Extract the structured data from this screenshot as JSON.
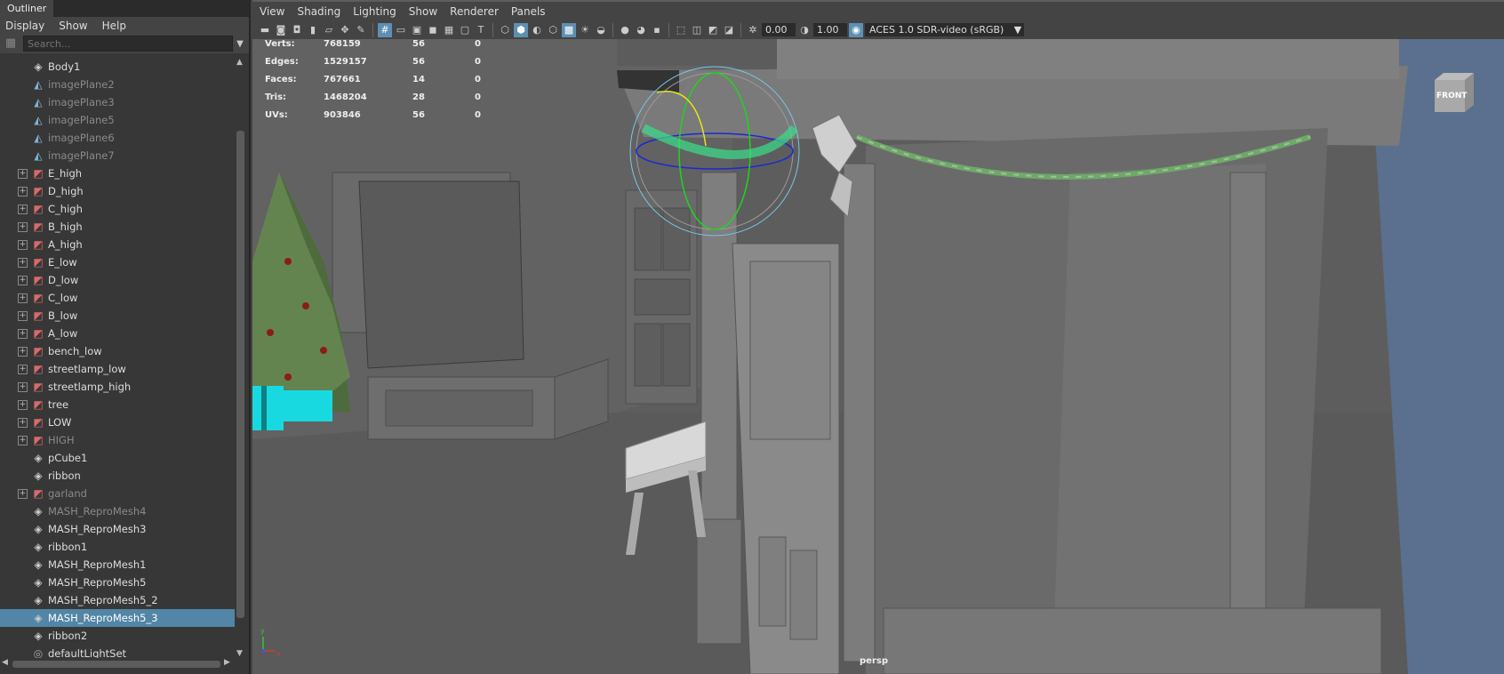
{
  "outliner": {
    "title": "Outliner",
    "menu": [
      "Display",
      "Show",
      "Help"
    ],
    "search_placeholder": "Search...",
    "items": [
      {
        "label": "Body1",
        "icon": "mesh-icon",
        "expand": false,
        "dim": false,
        "selected": false
      },
      {
        "label": "imagePlane2",
        "icon": "image-plane-icon",
        "expand": false,
        "dim": true,
        "selected": false
      },
      {
        "label": "imagePlane3",
        "icon": "image-plane-icon",
        "expand": false,
        "dim": true,
        "selected": false
      },
      {
        "label": "imagePlane5",
        "icon": "image-plane-icon",
        "expand": false,
        "dim": true,
        "selected": false
      },
      {
        "label": "imagePlane6",
        "icon": "image-plane-icon",
        "expand": false,
        "dim": true,
        "selected": false
      },
      {
        "label": "imagePlane7",
        "icon": "image-plane-icon",
        "expand": false,
        "dim": true,
        "selected": false
      },
      {
        "label": "E_high",
        "icon": "group-icon",
        "expand": true,
        "dim": false,
        "selected": false
      },
      {
        "label": "D_high",
        "icon": "group-icon",
        "expand": true,
        "dim": false,
        "selected": false
      },
      {
        "label": "C_high",
        "icon": "group-icon",
        "expand": true,
        "dim": false,
        "selected": false
      },
      {
        "label": "B_high",
        "icon": "group-icon",
        "expand": true,
        "dim": false,
        "selected": false
      },
      {
        "label": "A_high",
        "icon": "group-icon",
        "expand": true,
        "dim": false,
        "selected": false
      },
      {
        "label": "E_low",
        "icon": "group-icon",
        "expand": true,
        "dim": false,
        "selected": false
      },
      {
        "label": "D_low",
        "icon": "group-icon",
        "expand": true,
        "dim": false,
        "selected": false
      },
      {
        "label": "C_low",
        "icon": "group-icon",
        "expand": true,
        "dim": false,
        "selected": false
      },
      {
        "label": "B_low",
        "icon": "group-icon",
        "expand": true,
        "dim": false,
        "selected": false
      },
      {
        "label": "A_low",
        "icon": "group-icon",
        "expand": true,
        "dim": false,
        "selected": false
      },
      {
        "label": "bench_low",
        "icon": "group-icon",
        "expand": true,
        "dim": false,
        "selected": false
      },
      {
        "label": "streetlamp_low",
        "icon": "group-icon",
        "expand": true,
        "dim": false,
        "selected": false
      },
      {
        "label": "streetlamp_high",
        "icon": "group-icon",
        "expand": true,
        "dim": false,
        "selected": false
      },
      {
        "label": "tree",
        "icon": "group-icon",
        "expand": true,
        "dim": false,
        "selected": false
      },
      {
        "label": "LOW",
        "icon": "group-icon",
        "expand": true,
        "dim": false,
        "selected": false
      },
      {
        "label": "HIGH",
        "icon": "group-icon",
        "expand": true,
        "dim": true,
        "selected": false
      },
      {
        "label": "pCube1",
        "icon": "mesh-icon",
        "expand": false,
        "dim": false,
        "selected": false
      },
      {
        "label": "ribbon",
        "icon": "mesh-icon",
        "expand": false,
        "dim": false,
        "selected": false
      },
      {
        "label": "garland",
        "icon": "group-icon",
        "expand": true,
        "dim": true,
        "selected": false
      },
      {
        "label": "MASH_ReproMesh4",
        "icon": "mesh-icon",
        "expand": false,
        "dim": true,
        "selected": false
      },
      {
        "label": "MASH_ReproMesh3",
        "icon": "mesh-icon",
        "expand": false,
        "dim": false,
        "selected": false
      },
      {
        "label": "ribbon1",
        "icon": "mesh-icon",
        "expand": false,
        "dim": false,
        "selected": false
      },
      {
        "label": "MASH_ReproMesh1",
        "icon": "mesh-icon",
        "expand": false,
        "dim": false,
        "selected": false
      },
      {
        "label": "MASH_ReproMesh5",
        "icon": "mesh-icon",
        "expand": false,
        "dim": false,
        "selected": false
      },
      {
        "label": "MASH_ReproMesh5_2",
        "icon": "mesh-icon",
        "expand": false,
        "dim": false,
        "selected": false
      },
      {
        "label": "MASH_ReproMesh5_3",
        "icon": "mesh-icon",
        "expand": false,
        "dim": false,
        "selected": true
      },
      {
        "label": "ribbon2",
        "icon": "mesh-icon",
        "expand": false,
        "dim": false,
        "selected": false
      },
      {
        "label": "defaultLightSet",
        "icon": "light-set-icon",
        "expand": false,
        "dim": false,
        "selected": false
      }
    ]
  },
  "viewport": {
    "menu": [
      "View",
      "Shading",
      "Lighting",
      "Show",
      "Renderer",
      "Panels"
    ],
    "exposure": "0.00",
    "gamma": "1.00",
    "color_space": "ACES 1.0 SDR-video (sRGB)",
    "camera_label": "persp",
    "viewcube_label": "FRONT",
    "hud_stats": [
      {
        "label": "Verts:",
        "total": "768159",
        "selected": "56",
        "uv": "0"
      },
      {
        "label": "Edges:",
        "total": "1529157",
        "selected": "56",
        "uv": "0"
      },
      {
        "label": "Faces:",
        "total": "767661",
        "selected": "14",
        "uv": "0"
      },
      {
        "label": "Tris:",
        "total": "1468204",
        "selected": "28",
        "uv": "0"
      },
      {
        "label": "UVs:",
        "total": "903846",
        "selected": "56",
        "uv": "0"
      }
    ],
    "axis_labels": {
      "y": "y",
      "x": "x"
    }
  },
  "colors": {
    "selection": "#5285a6",
    "accent": "#5e8fb3",
    "garland": "#6fa86a",
    "gift": "#19d9e0"
  }
}
